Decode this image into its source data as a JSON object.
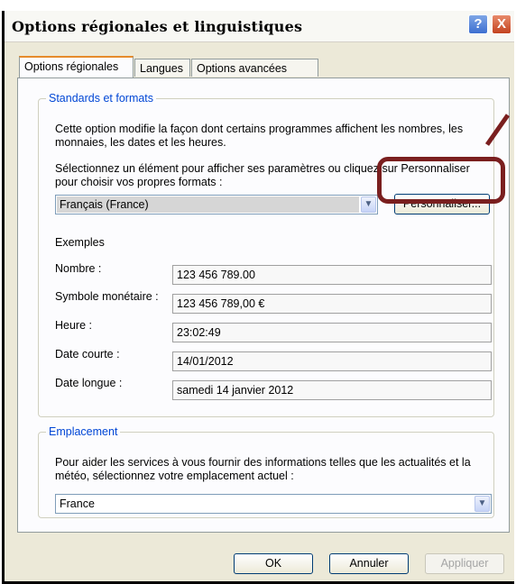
{
  "window": {
    "title": "Options régionales et linguistiques",
    "help_glyph": "?",
    "close_glyph": "X"
  },
  "tabs": [
    {
      "label": "Options régionales",
      "active": true
    },
    {
      "label": "Langues",
      "active": false
    },
    {
      "label": "Options avancées",
      "active": false
    }
  ],
  "standards": {
    "legend": "Standards et formats",
    "description": "Cette option modifie la façon dont certains programmes affichent les nombres, les monnaies, les dates et les heures.",
    "instruction": "Sélectionnez un élément pour afficher ses paramètres ou cliquez sur Personnaliser pour choisir vos propres formats :",
    "selected_format": "Français (France)",
    "customize_button": "Personnaliser...",
    "examples_label": "Exemples",
    "examples": [
      {
        "label": "Nombre :",
        "value": "123 456 789.00"
      },
      {
        "label": "Symbole monétaire :",
        "value": "123 456 789,00 €"
      },
      {
        "label": "Heure :",
        "value": "23:02:49"
      },
      {
        "label": "Date courte :",
        "value": "14/01/2012"
      },
      {
        "label": "Date longue :",
        "value": "samedi 14 janvier 2012"
      }
    ]
  },
  "location": {
    "legend": "Emplacement",
    "description": "Pour aider les services à vous fournir des informations telles que les actualités et la météo, sélectionnez votre emplacement actuel :",
    "selected": "France"
  },
  "buttons": {
    "ok": "OK",
    "cancel": "Annuler",
    "apply": "Appliquer"
  },
  "colors": {
    "accent_blue": "#0046d5",
    "callout": "#7a1f1f",
    "tab_highlight": "#e68b2c"
  },
  "icons": {
    "combo_arrow": "chevron-down-icon"
  }
}
